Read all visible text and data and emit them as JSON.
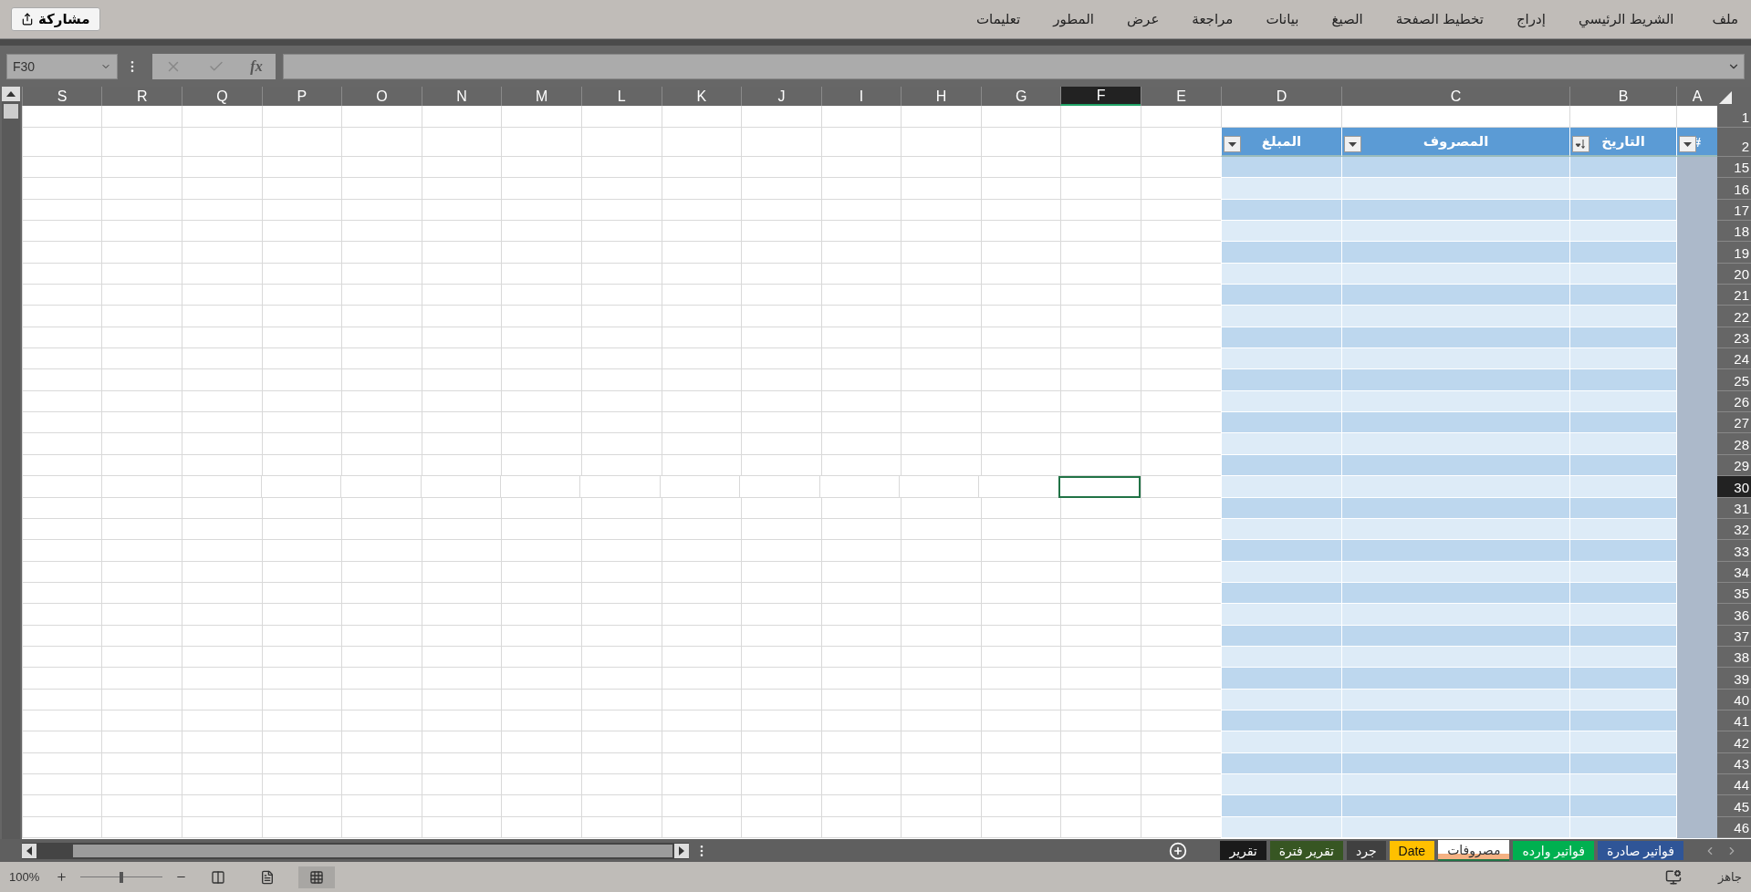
{
  "ribbon": {
    "share_button": "مشاركة",
    "tabs": [
      {
        "label": "ملف"
      },
      {
        "label": "الشريط الرئيسي"
      },
      {
        "label": "إدراج"
      },
      {
        "label": "تخطيط الصفحة"
      },
      {
        "label": "الصيغ"
      },
      {
        "label": "بيانات"
      },
      {
        "label": "مراجعة"
      },
      {
        "label": "عرض"
      },
      {
        "label": "المطور"
      },
      {
        "label": "تعليمات"
      }
    ]
  },
  "formula_bar": {
    "name_box": "F30",
    "function_label": "fx"
  },
  "columns": [
    {
      "label": "A",
      "selected": false
    },
    {
      "label": "B",
      "selected": false
    },
    {
      "label": "C",
      "selected": false
    },
    {
      "label": "D",
      "selected": false
    },
    {
      "label": "E",
      "selected": false
    },
    {
      "label": "F",
      "selected": true
    },
    {
      "label": "G",
      "selected": false
    },
    {
      "label": "H",
      "selected": false
    },
    {
      "label": "I",
      "selected": false
    },
    {
      "label": "J",
      "selected": false
    },
    {
      "label": "K",
      "selected": false
    },
    {
      "label": "L",
      "selected": false
    },
    {
      "label": "M",
      "selected": false
    },
    {
      "label": "N",
      "selected": false
    },
    {
      "label": "O",
      "selected": false
    },
    {
      "label": "P",
      "selected": false
    },
    {
      "label": "Q",
      "selected": false
    },
    {
      "label": "R",
      "selected": false
    },
    {
      "label": "S",
      "selected": false
    }
  ],
  "table": {
    "headers": [
      {
        "label": "#",
        "kind": "filter"
      },
      {
        "label": "التاريخ",
        "kind": "sorted"
      },
      {
        "label": "المصروف",
        "kind": "filter"
      },
      {
        "label": "المبلغ",
        "kind": "filter"
      }
    ]
  },
  "rows": [
    {
      "label": "1",
      "kind": "blank",
      "selected": false
    },
    {
      "label": "2",
      "kind": "header",
      "selected": false
    },
    {
      "label": "15",
      "kind": "data",
      "selected": false
    },
    {
      "label": "16",
      "kind": "data",
      "selected": false
    },
    {
      "label": "17",
      "kind": "data",
      "selected": false
    },
    {
      "label": "18",
      "kind": "data",
      "selected": false
    },
    {
      "label": "19",
      "kind": "data",
      "selected": false
    },
    {
      "label": "20",
      "kind": "data",
      "selected": false
    },
    {
      "label": "21",
      "kind": "data",
      "selected": false
    },
    {
      "label": "22",
      "kind": "data",
      "selected": false
    },
    {
      "label": "23",
      "kind": "data",
      "selected": false
    },
    {
      "label": "24",
      "kind": "data",
      "selected": false
    },
    {
      "label": "25",
      "kind": "data",
      "selected": false
    },
    {
      "label": "26",
      "kind": "data",
      "selected": false
    },
    {
      "label": "27",
      "kind": "data",
      "selected": false
    },
    {
      "label": "28",
      "kind": "data",
      "selected": false
    },
    {
      "label": "29",
      "kind": "data",
      "selected": false
    },
    {
      "label": "30",
      "kind": "data",
      "selected": true
    },
    {
      "label": "31",
      "kind": "data",
      "selected": false
    },
    {
      "label": "32",
      "kind": "data",
      "selected": false
    },
    {
      "label": "33",
      "kind": "data",
      "selected": false
    },
    {
      "label": "34",
      "kind": "data",
      "selected": false
    },
    {
      "label": "35",
      "kind": "data",
      "selected": false
    },
    {
      "label": "36",
      "kind": "data",
      "selected": false
    },
    {
      "label": "37",
      "kind": "data",
      "selected": false
    },
    {
      "label": "38",
      "kind": "data",
      "selected": false
    },
    {
      "label": "39",
      "kind": "data",
      "selected": false
    },
    {
      "label": "40",
      "kind": "data",
      "selected": false
    },
    {
      "label": "41",
      "kind": "data",
      "selected": false
    },
    {
      "label": "42",
      "kind": "data",
      "selected": false
    },
    {
      "label": "43",
      "kind": "data",
      "selected": false
    },
    {
      "label": "44",
      "kind": "data",
      "selected": false
    },
    {
      "label": "45",
      "kind": "data",
      "selected": false
    },
    {
      "label": "46",
      "kind": "data",
      "selected": false
    }
  ],
  "sheet_tabs": [
    {
      "label": "فواتير صادرة",
      "color": "#2f5597",
      "selected": false
    },
    {
      "label": "فواتير وارده",
      "color": "#00b050",
      "selected": false
    },
    {
      "label": "مصروفات",
      "color": "#f4b183",
      "selected": true
    },
    {
      "label": "Date",
      "color": "#ffc000",
      "selected": false
    },
    {
      "label": "جرد",
      "color": "#404040",
      "selected": false
    },
    {
      "label": "تقرير فترة",
      "color": "#375623",
      "selected": false
    },
    {
      "label": "تقرير",
      "color": "#1a1a1a",
      "selected": false
    }
  ],
  "status_bar": {
    "status": "جاهز",
    "zoom": "100%",
    "zoom_slider": {
      "level": 0.5
    },
    "view": [
      {
        "kind": "page_layout",
        "selected": false
      },
      {
        "kind": "page_break",
        "selected": false
      },
      {
        "kind": "normal",
        "selected": true
      }
    ]
  }
}
